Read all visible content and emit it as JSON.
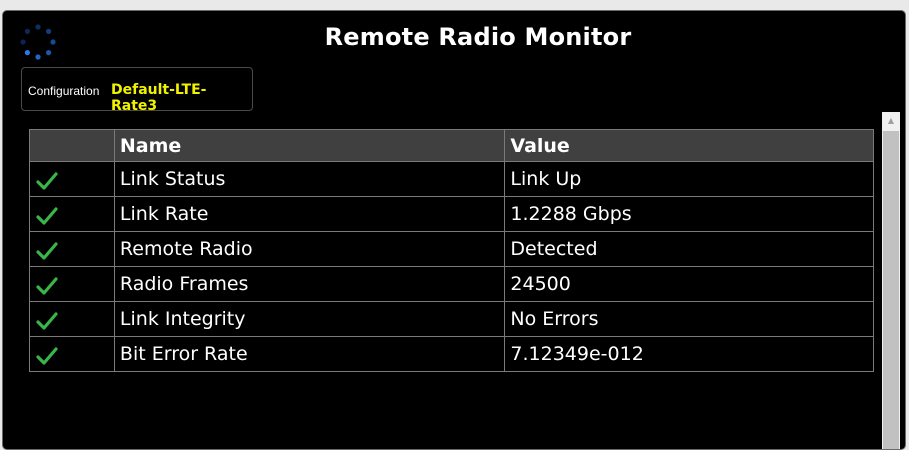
{
  "header": {
    "title": "Remote Radio Monitor"
  },
  "config": {
    "label": "Configuration",
    "value": "Default-LTE-Rate3"
  },
  "table": {
    "columns": [
      "",
      "Name",
      "Value"
    ],
    "rows": [
      {
        "status": "check-icon",
        "name": "Link Status",
        "value": "Link Up"
      },
      {
        "status": "check-icon",
        "name": "Link Rate",
        "value": "1.2288 Gbps"
      },
      {
        "status": "check-icon",
        "name": "Remote Radio",
        "value": "Detected"
      },
      {
        "status": "check-icon",
        "name": "Radio Frames",
        "value": "24500"
      },
      {
        "status": "check-icon",
        "name": "Link Integrity",
        "value": "No Errors"
      },
      {
        "status": "check-icon",
        "name": "Bit Error Rate",
        "value": "7.12349e-012"
      }
    ]
  },
  "colors": {
    "check": "#39b54a",
    "config_value": "#f2f200",
    "spinner": "#1f6fd6",
    "header_bg": "#404040"
  }
}
